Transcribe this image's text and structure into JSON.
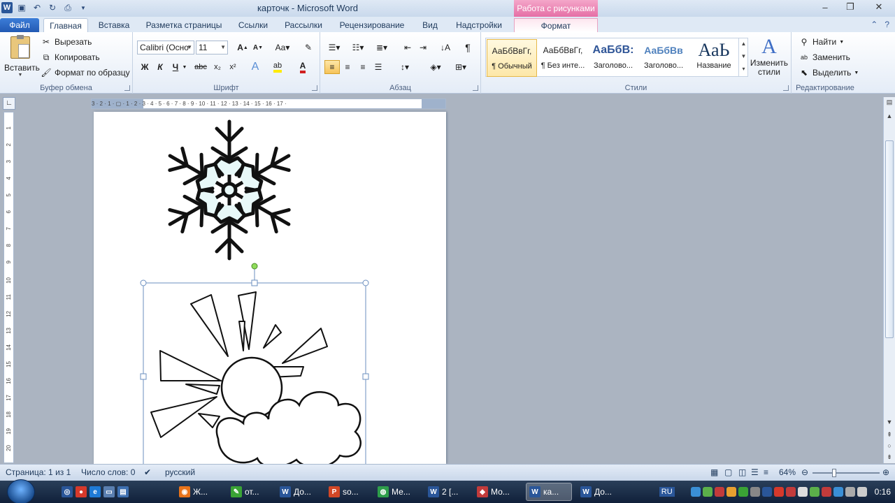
{
  "window": {
    "title": "карточк  -  Microsoft Word",
    "context_header": "Работа с рисунками"
  },
  "tabs": [
    "Файл",
    "Главная",
    "Вставка",
    "Разметка страницы",
    "Ссылки",
    "Рассылки",
    "Рецензирование",
    "Вид",
    "Надстройки",
    "Формат"
  ],
  "ribbon": {
    "clipboard": {
      "paste": "Вставить",
      "cut": "Вырезать",
      "copy": "Копировать",
      "format_painter": "Формат по образцу",
      "label": "Буфер обмена"
    },
    "font": {
      "name": "Calibri (Осно",
      "size": "11",
      "label": "Шрифт"
    },
    "paragraph": {
      "label": "Абзац"
    },
    "styles": {
      "label": "Стили",
      "items": [
        {
          "preview": "АаБбВвГг,",
          "name": "¶ Обычный"
        },
        {
          "preview": "АаБбВвГг,",
          "name": "¶ Без инте..."
        },
        {
          "preview": "АаБбВ:",
          "name": "Заголово..."
        },
        {
          "preview": "АаБбВв",
          "name": "Заголово..."
        },
        {
          "preview": "АаЬ",
          "name": "Название"
        }
      ],
      "change": "Изменить стили"
    },
    "editing": {
      "find": "Найти",
      "replace": "Заменить",
      "select": "Выделить",
      "label": "Редактирование"
    }
  },
  "ruler": {
    "h_ticks": "3 · 2 · 1 · ▢ · 1 · 2 · 3 · 4 · 5 · 6 · 7 · 8 · 9 · 10 · 11 · 12 · 13 · 14 · 15 · 16 · 17 ·",
    "v_ticks": [
      "1",
      "2",
      "3",
      "4",
      "5",
      "6",
      "7",
      "8",
      "9",
      "10",
      "11",
      "12",
      "13",
      "14",
      "15",
      "16",
      "17",
      "18",
      "19",
      "20"
    ]
  },
  "status": {
    "page": "Страница: 1 из 1",
    "words": "Число слов: 0",
    "language": "русский",
    "zoom": "64%"
  },
  "taskbar": {
    "items": [
      {
        "label": "Ж...",
        "color": "#e8731a",
        "glyph": "◉"
      },
      {
        "label": "от...",
        "color": "#3aa335",
        "glyph": "✎"
      },
      {
        "label": "До...",
        "color": "#2a5699",
        "glyph": "W"
      },
      {
        "label": "so...",
        "color": "#d24726",
        "glyph": "P"
      },
      {
        "label": "Ме...",
        "color": "#2e9e4b",
        "glyph": "◍"
      },
      {
        "label": "2 [...",
        "color": "#2a5699",
        "glyph": "W"
      },
      {
        "label": "Мо...",
        "color": "#c23b3b",
        "glyph": "◆"
      },
      {
        "label": "ка...",
        "color": "#2a5699",
        "glyph": "W",
        "active": true
      },
      {
        "label": "До...",
        "color": "#2a5699",
        "glyph": "W"
      }
    ],
    "lang": "RU",
    "clock": "0:16"
  }
}
